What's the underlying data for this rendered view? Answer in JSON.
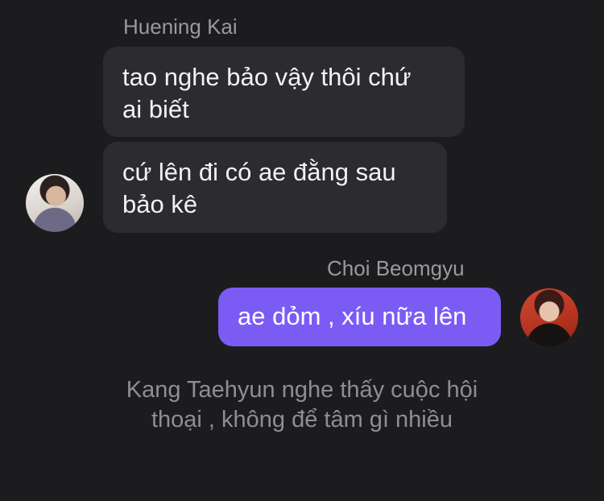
{
  "chat": {
    "messages": [
      {
        "sender": "Huening Kai",
        "direction": "incoming",
        "bubbles": [
          {
            "lines": [
              "tao nghe bảo vậy thôi chứ",
              "ai biết"
            ]
          },
          {
            "lines": [
              "cứ lên đi có ae đằng sau",
              "bảo kê"
            ]
          }
        ],
        "avatar_icon": "user-avatar-photo"
      },
      {
        "sender": "Choi Beomgyu",
        "direction": "outgoing",
        "bubbles": [
          {
            "lines": [
              "ae dỏm , xíu nữa lên"
            ]
          }
        ],
        "avatar_icon": "user-avatar-photo"
      }
    ],
    "system_note": {
      "lines": [
        "Kang Taehyun nghe thấy cuộc hội",
        "thoại , không để tâm gì nhiều"
      ]
    }
  },
  "colors": {
    "background": "#1c1c1e",
    "incoming_bubble": "#2c2c2e",
    "outgoing_bubble": "#7a5cf5",
    "name_text": "#9a9a9e",
    "system_text": "#8e8e93"
  }
}
